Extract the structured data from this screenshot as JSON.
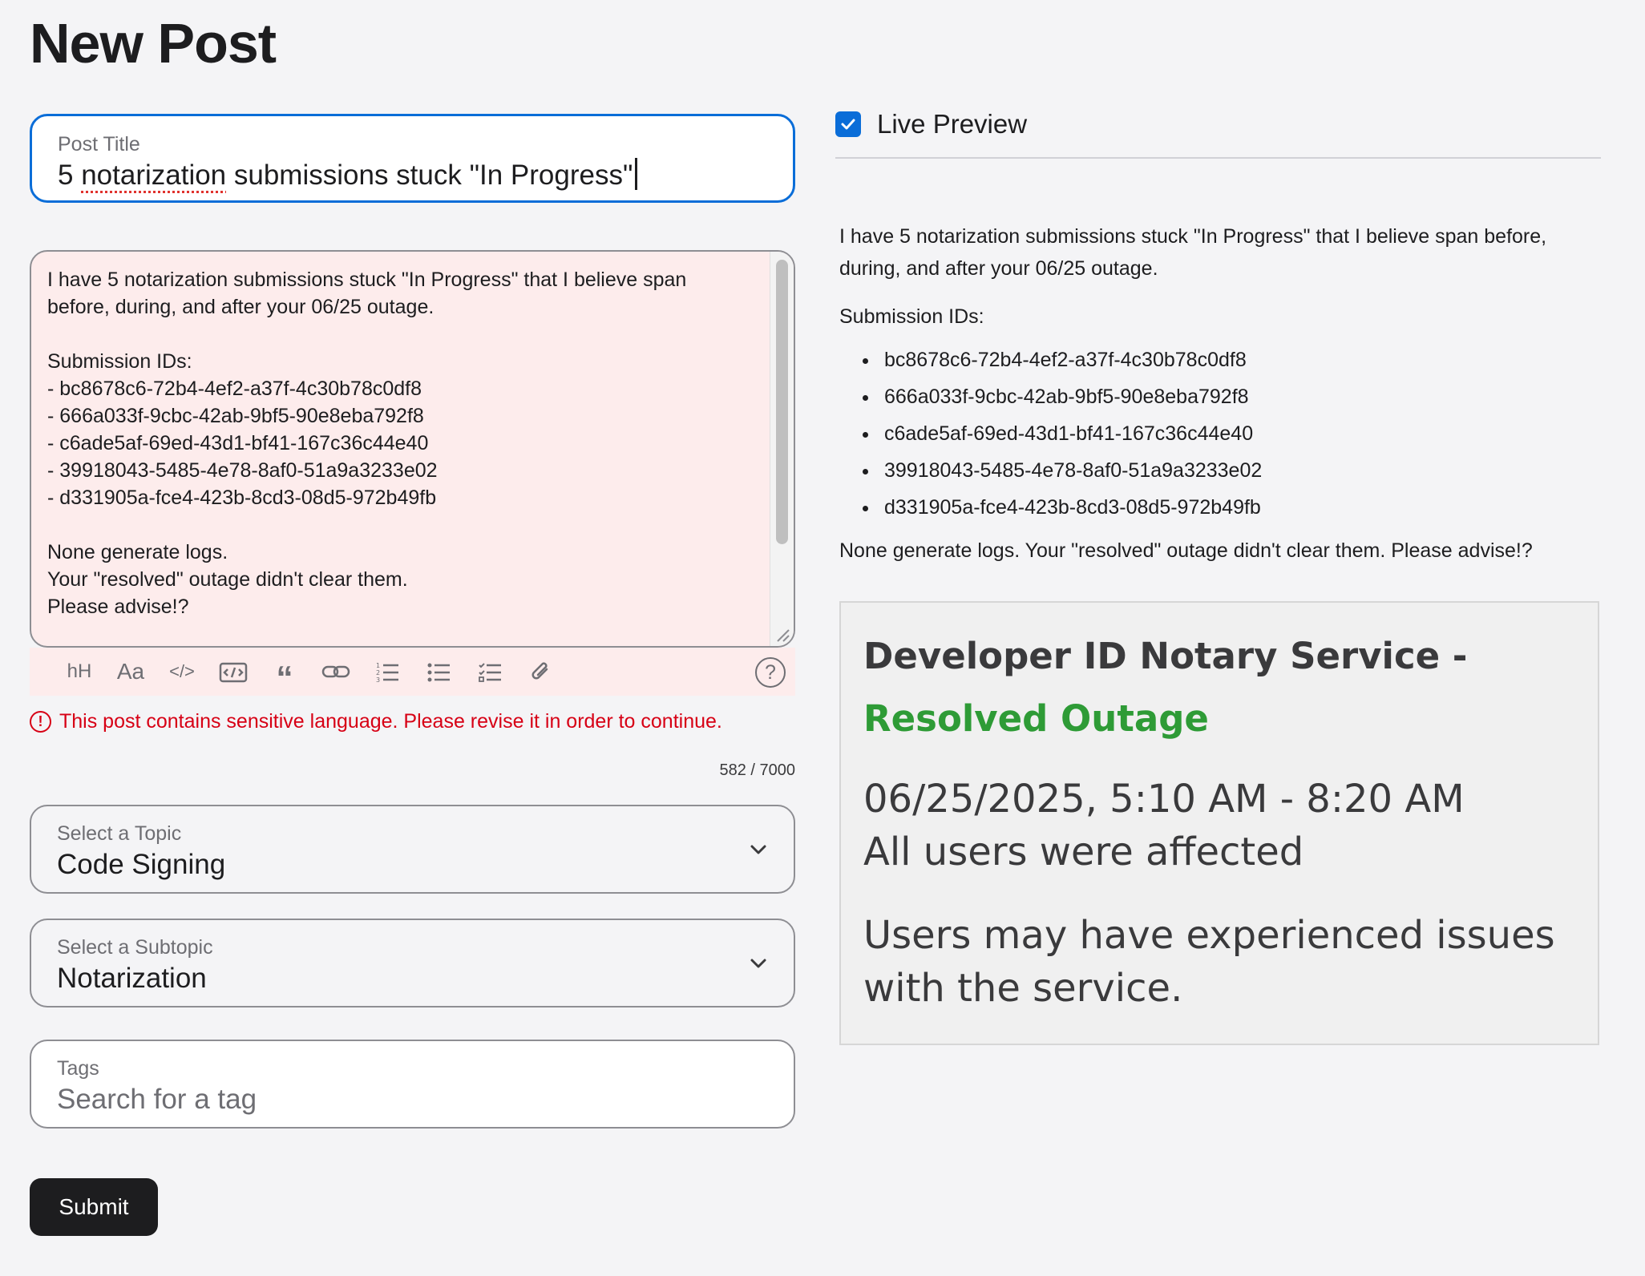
{
  "page": {
    "title": "New Post"
  },
  "post_title": {
    "label": "Post Title",
    "value_word1": "5 ",
    "value_misspelled": "notarization",
    "value_rest": " submissions stuck \"In Progress\""
  },
  "body_editor": {
    "lines": [
      "I have 5 notarization submissions stuck \"In Progress\" that I believe span",
      "before, during, and after your 06/25 outage.",
      "",
      "Submission IDs:",
      "- bc8678c6-72b4-4ef2-a37f-4c30b78c0df8",
      "- 666a033f-9cbc-42ab-9bf5-90e8eba792f8",
      "- c6ade5af-69ed-43d1-bf41-167c36c44e40",
      "- 39918043-5485-4e78-8af0-51a9a3233e02",
      "- d331905a-fce4-423b-8cd3-08d5-972b49fb",
      "",
      "None generate logs.",
      "Your \"resolved\" outage didn't clear them.",
      "Please advise!?"
    ]
  },
  "toolbar": {
    "heading_icon": "hH",
    "font_icon": "Aa",
    "code_icon": "</>",
    "quote_icon": "“",
    "help_icon": "?"
  },
  "error": {
    "message": "This post contains sensitive language. Please revise it in order to continue.",
    "icon": "!"
  },
  "char_count": "582 / 7000",
  "topic": {
    "label": "Select a Topic",
    "value": "Code Signing"
  },
  "subtopic": {
    "label": "Select a Subtopic",
    "value": "Notarization"
  },
  "tags": {
    "label": "Tags",
    "placeholder": "Search for a tag"
  },
  "submit": {
    "label": "Submit"
  },
  "live_preview": {
    "label": "Live Preview",
    "checked": true,
    "intro": "I have 5 notarization submissions stuck \"In Progress\" that I believe span before, during, and after your 06/25 outage.",
    "ids_heading": "Submission IDs:",
    "ids": [
      "bc8678c6-72b4-4ef2-a37f-4c30b78c0df8",
      "666a033f-9cbc-42ab-9bf5-90e8eba792f8",
      "c6ade5af-69ed-43d1-bf41-167c36c44e40",
      "39918043-5485-4e78-8af0-51a9a3233e02",
      "d331905a-fce4-423b-8cd3-08d5-972b49fb"
    ],
    "outro": "None generate logs. Your \"resolved\" outage didn't clear them. Please advise!?",
    "embed": {
      "title": "Developer ID Notary Service -",
      "status": "Resolved Outage",
      "time": "06/25/2025, 5:10 AM - 8:20 AM",
      "affected": "All users were affected",
      "description": "Users may have experienced issues with the service."
    }
  },
  "colors": {
    "accent": "#0a6dd8",
    "error": "#d70015",
    "resolved": "#2e9b36",
    "editor_bg": "#fdecec"
  }
}
